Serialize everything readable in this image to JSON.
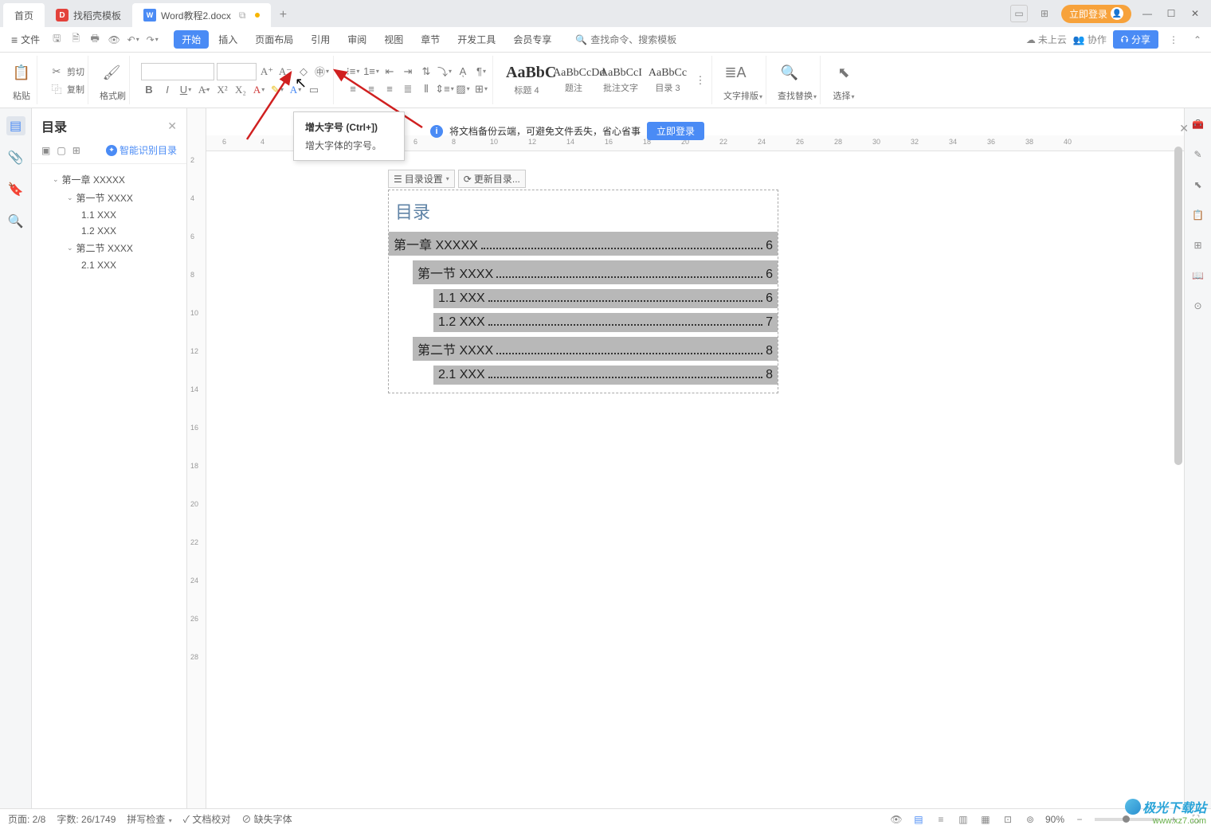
{
  "tabs": {
    "home": "首页",
    "template": "找稻壳模板",
    "doc": "Word教程2.docx"
  },
  "titlebar": {
    "login": "立即登录"
  },
  "menu": {
    "file": "文件",
    "items": [
      "开始",
      "插入",
      "页面布局",
      "引用",
      "审阅",
      "视图",
      "章节",
      "开发工具",
      "会员专享"
    ],
    "search_placeholder": "查找命令、搜索模板",
    "cloud": "未上云",
    "collab": "协作",
    "share": "分享"
  },
  "ribbon": {
    "paste": "粘贴",
    "cut": "剪切",
    "copy": "复制",
    "format_painter": "格式刷",
    "styles": [
      {
        "preview": "AaBbC",
        "label": "标题 4",
        "big": true
      },
      {
        "preview": "AaBbCcDd",
        "label": "题注"
      },
      {
        "preview": "AaBbCcI",
        "label": "批注文字"
      },
      {
        "preview": "AaBbCc",
        "label": "目录 3"
      }
    ],
    "text_layout": "文字排版",
    "find_replace": "查找替换",
    "select": "选择"
  },
  "tooltip": {
    "title": "增大字号 (Ctrl+])",
    "desc": "增大字体的字号。"
  },
  "banner": {
    "text": "将文档备份云端，可避免文件丢失，省心省事",
    "button": "立即登录"
  },
  "nav": {
    "title": "目录",
    "smart": "智能识别目录",
    "tree": [
      {
        "level": 1,
        "text": "第一章  XXXXX",
        "caret": true
      },
      {
        "level": 2,
        "text": "第一节  XXXX",
        "caret": true
      },
      {
        "level": 3,
        "text": "1.1 XXX"
      },
      {
        "level": 3,
        "text": "1.2 XXX"
      },
      {
        "level": 2,
        "text": "第二节  XXXX",
        "caret": true
      },
      {
        "level": 3,
        "text": "2.1 XXX"
      }
    ]
  },
  "toc_controls": {
    "settings": "目录设置",
    "update": "更新目录..."
  },
  "doc": {
    "toc_title": "目录",
    "rows": [
      {
        "level": 1,
        "text": "第一章  XXXXX",
        "page": "6"
      },
      {
        "level": 2,
        "text": "第一节  XXXX",
        "page": "6"
      },
      {
        "level": 3,
        "text": "1.1 XXX",
        "page": "6"
      },
      {
        "level": 3,
        "text": "1.2 XXX",
        "page": "7"
      },
      {
        "level": 2,
        "text": "第二节  XXXX",
        "page": "8"
      },
      {
        "level": 3,
        "text": "2.1 XXX",
        "page": "8"
      }
    ]
  },
  "ruler_h": [
    6,
    4,
    2,
    2,
    4,
    6,
    8,
    10,
    12,
    14,
    16,
    18,
    20,
    22,
    24,
    26,
    28,
    30,
    32,
    34,
    36,
    38,
    40
  ],
  "ruler_v": [
    2,
    4,
    6,
    8,
    10,
    12,
    14,
    16,
    18,
    20,
    22,
    24,
    26,
    28
  ],
  "status": {
    "page": "页面: 2/8",
    "words": "字数: 26/1749",
    "spell": "拼写检查",
    "proof": "文档校对",
    "missing": "缺失字体",
    "zoom": "90%"
  },
  "watermark": {
    "name": "极光下载站",
    "url": "www.xz7.com"
  }
}
